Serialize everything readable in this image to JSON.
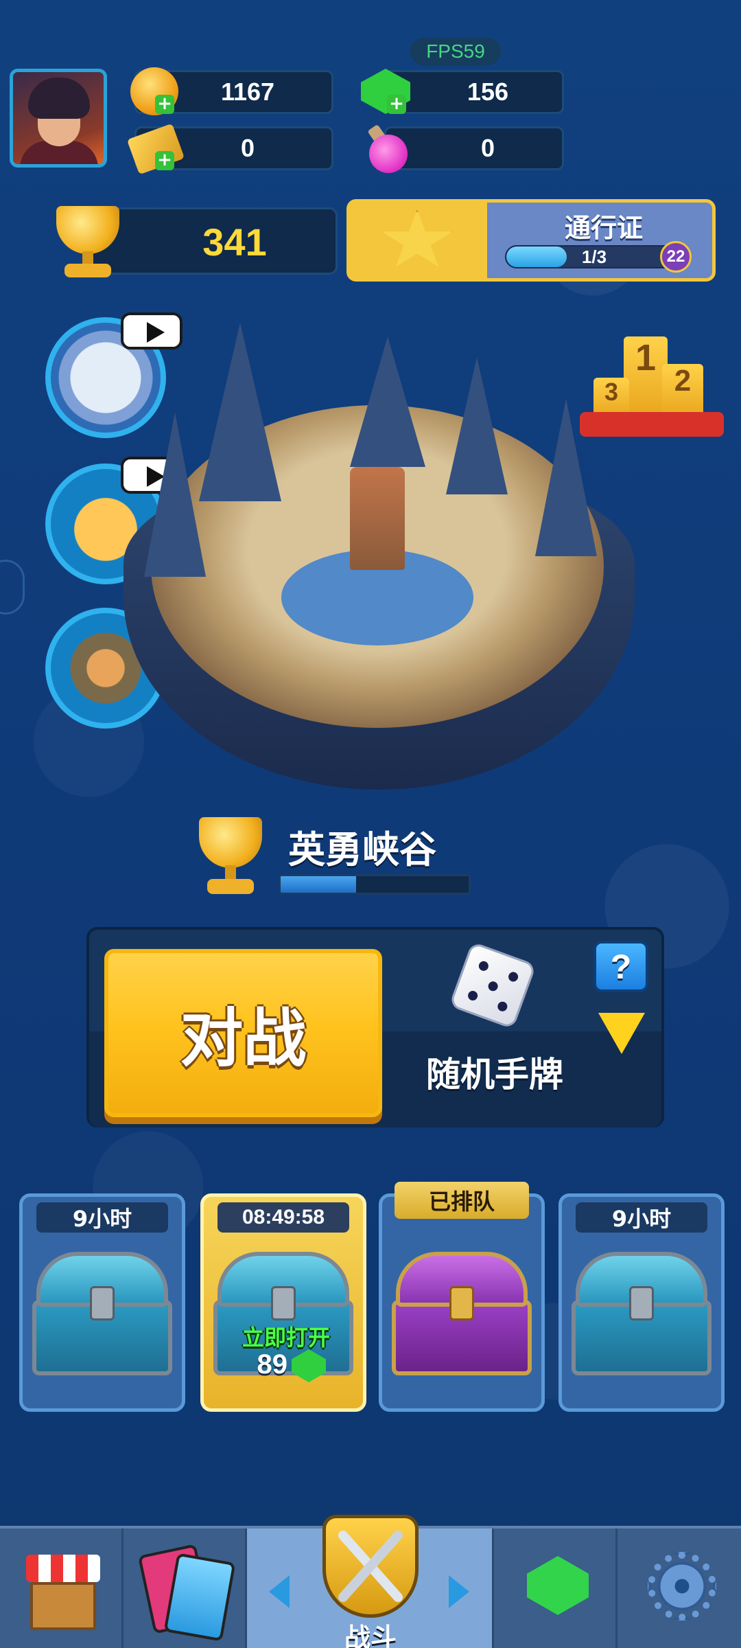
{
  "fps": "FPS59",
  "resources": {
    "coins": "1167",
    "gems": "156",
    "tickets": "0",
    "potions": "0"
  },
  "trophies": "341",
  "pass": {
    "title": "通行证",
    "progress": "1/3",
    "progress_fraction": 0.33,
    "level": "22"
  },
  "arena": {
    "name": "英勇峡谷",
    "progress_fraction": 0.4
  },
  "battle": {
    "button_label": "对战",
    "mode_label": "随机手牌",
    "help_label": "?"
  },
  "chests": [
    {
      "label": "9小时",
      "state": "locked",
      "color": "blue"
    },
    {
      "label": "08:49:58",
      "state": "unlocking",
      "color": "blue",
      "open_now": "立即打开",
      "cost": "89"
    },
    {
      "label": "已排队",
      "state": "queued",
      "color": "purple"
    },
    {
      "label": "9小时",
      "state": "locked",
      "color": "blue"
    }
  ],
  "nav": {
    "battle_label": "战斗"
  },
  "colors": {
    "background": "#0f3a78",
    "gold": "#ffc31e",
    "gem_green": "#2fcf3f",
    "accent_blue": "#2aa3e6"
  }
}
